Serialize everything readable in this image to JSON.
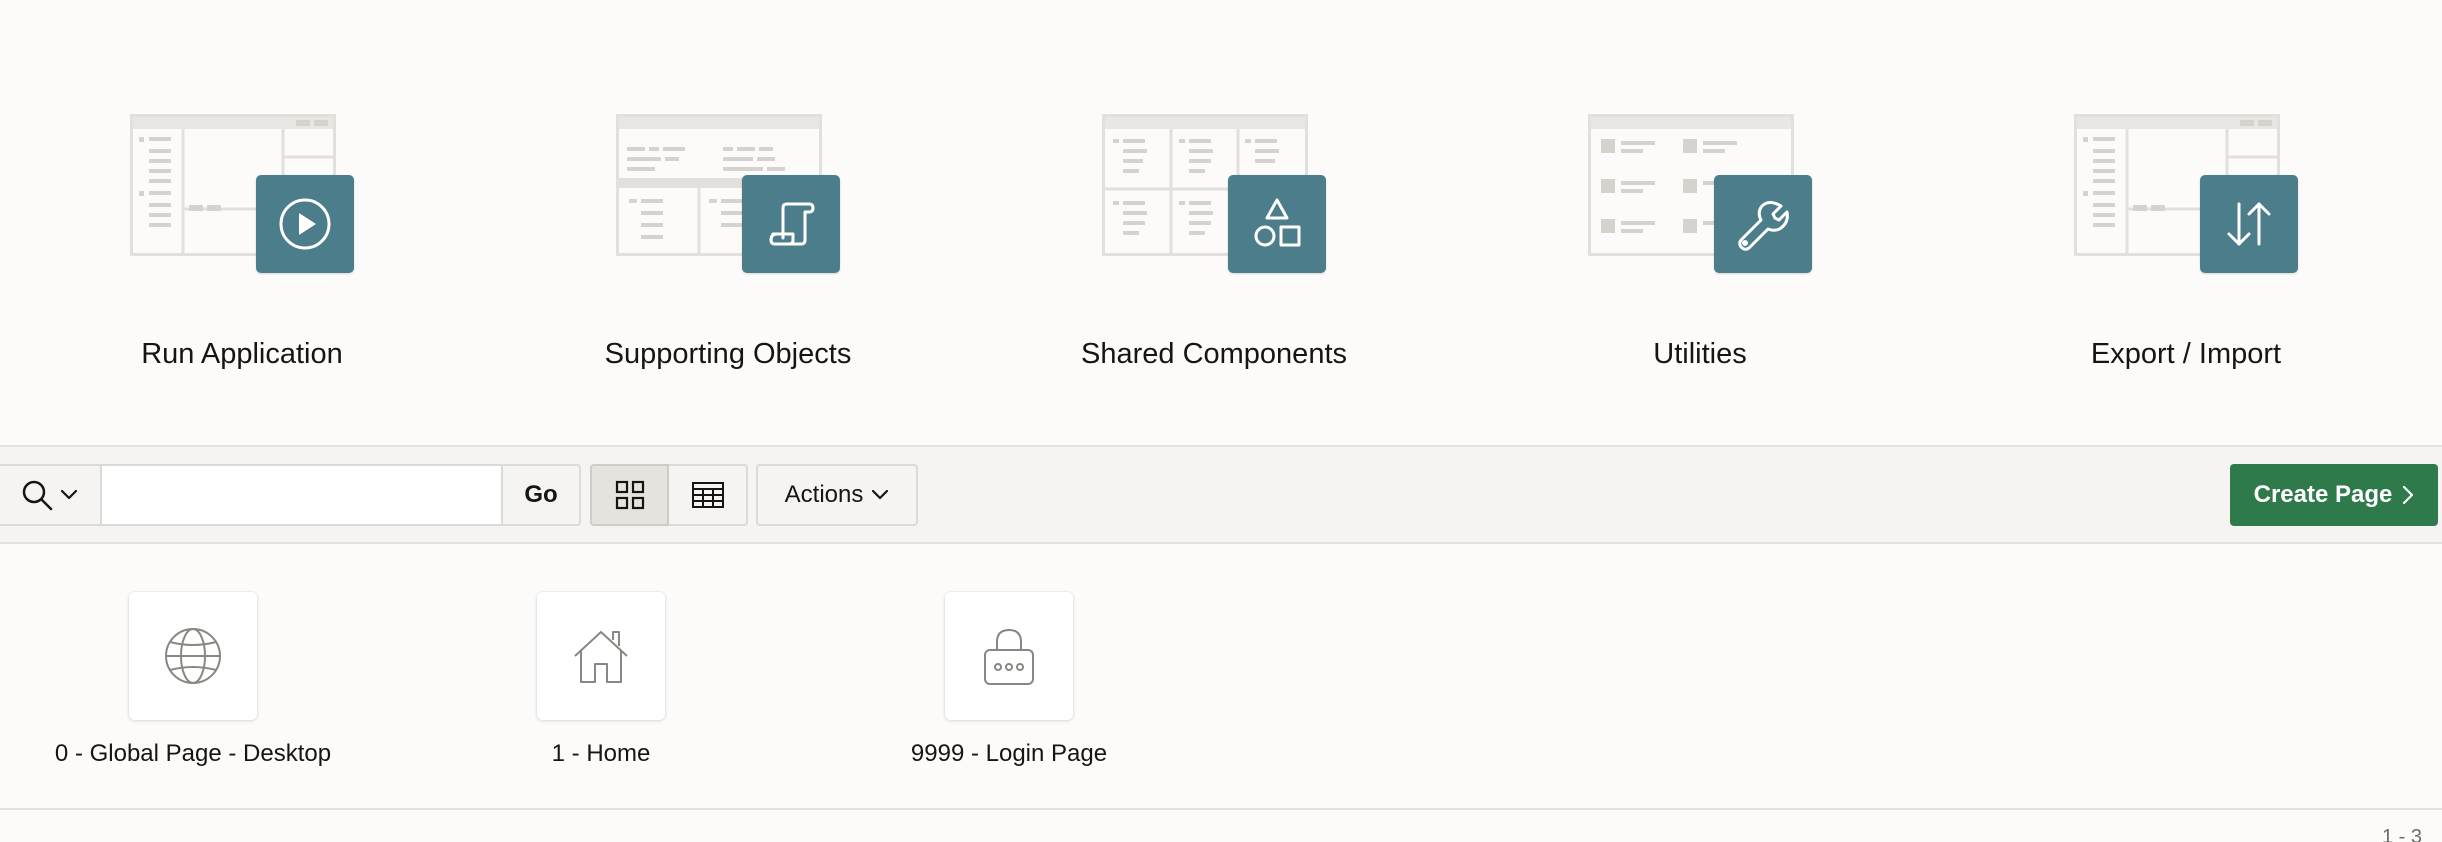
{
  "tiles": [
    {
      "label": "Run Application",
      "icon": "play-icon"
    },
    {
      "label": "Supporting Objects",
      "icon": "scroll-icon"
    },
    {
      "label": "Shared Components",
      "icon": "shapes-icon"
    },
    {
      "label": "Utilities",
      "icon": "wrench-icon"
    },
    {
      "label": "Export / Import",
      "icon": "arrows-up-down-icon"
    }
  ],
  "toolbar": {
    "search_value": "",
    "go_label": "Go",
    "actions_label": "Actions",
    "create_label": "Create Page"
  },
  "pages": [
    {
      "label": "0 - Global Page - Desktop",
      "icon": "globe-icon"
    },
    {
      "label": "1 - Home",
      "icon": "home-icon"
    },
    {
      "label": "9999 - Login Page",
      "icon": "lock-icon"
    }
  ],
  "pager": "1 - 3",
  "colors": {
    "badge": "#4c7d8a",
    "create_button": "#2f7a4b",
    "background": "#fcfbfa"
  }
}
